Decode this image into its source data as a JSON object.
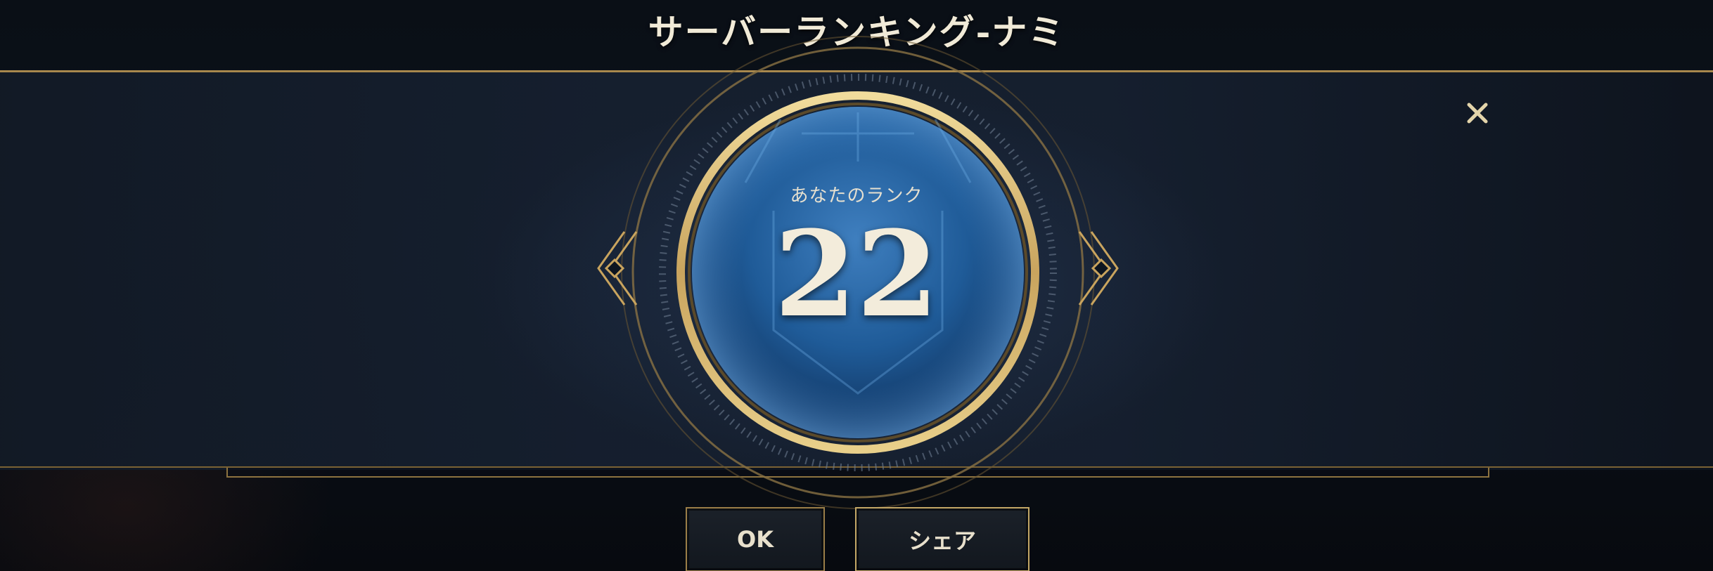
{
  "header": {
    "title": "サーバーランキング-ナミ"
  },
  "rank_panel": {
    "label": "あなたのランク",
    "rank": "22"
  },
  "buttons": {
    "ok_label": "OK",
    "share_label": "シェア"
  },
  "icons": {
    "close": "close-icon"
  },
  "colors": {
    "gold": "#c9ab6c",
    "orb_blue": "#1f5b98",
    "text_cream": "#f1ead7"
  }
}
